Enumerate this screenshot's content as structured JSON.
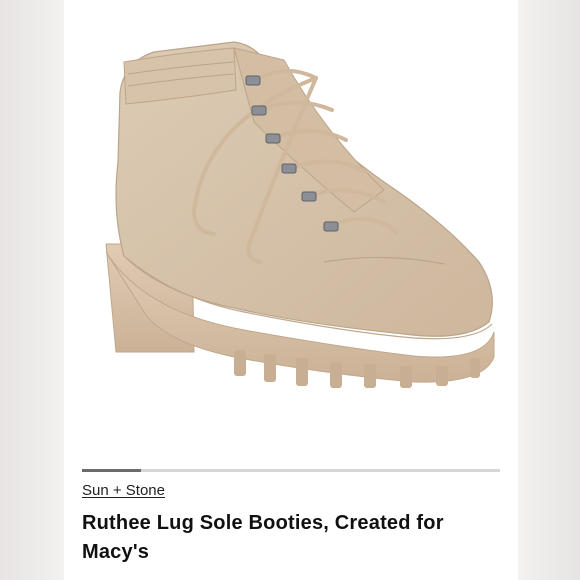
{
  "product": {
    "brand": "Sun + Stone",
    "title": "Ruthee Lug Sole Booties, Created for Macy's",
    "image_icon": "product-photo",
    "gallery_progress": 0.14
  },
  "colors": {
    "boot": "#d9c6ae",
    "sole": "#d8c2aa",
    "eyelet": "#8c9096",
    "text": "#111111"
  }
}
